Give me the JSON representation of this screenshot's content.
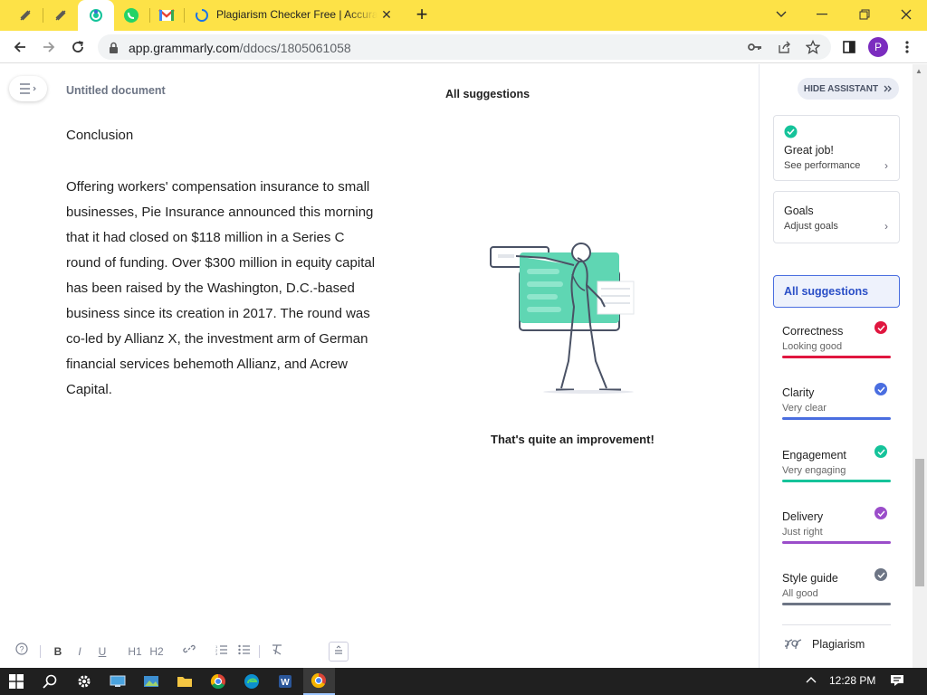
{
  "browser": {
    "tab": {
      "title": "Plagiarism Checker Free | Accurate"
    },
    "url": {
      "host": "app.grammarly.com",
      "path": "/ddocs/1805061058"
    },
    "profile_initial": "P"
  },
  "editor": {
    "doc_title": "Untitled document",
    "heading": "Conclusion",
    "body": "Offering workers' compensation insurance to small businesses, Pie Insurance announced this morning that it had closed on $118 million in a Series C round of funding. Over $300 million in equity capital has been raised by the Washington, D.C.-based business since its creation in 2017. The round was co-led by Allianz X, the investment arm of German financial services behemoth Allianz, and Acrew Capital.",
    "panel_title": "All suggestions",
    "improvement": "That's quite an improvement!",
    "format_bar": {
      "bold": "B",
      "italic": "I",
      "underline": "U",
      "h1": "H1",
      "h2": "H2"
    }
  },
  "assistant": {
    "hide_label": "HIDE ASSISTANT",
    "great_job": {
      "title": "Great job!",
      "subtitle": "See performance"
    },
    "goals": {
      "title": "Goals",
      "subtitle": "Adjust goals"
    },
    "all_suggestions": "All suggestions",
    "categories": [
      {
        "name": "Correctness",
        "status": "Looking good",
        "color": "#e0163f"
      },
      {
        "name": "Clarity",
        "status": "Very clear",
        "color": "#4a6ee0"
      },
      {
        "name": "Engagement",
        "status": "Very engaging",
        "color": "#15c39a"
      },
      {
        "name": "Delivery",
        "status": "Just right",
        "color": "#9b4dca"
      },
      {
        "name": "Style guide",
        "status": "All good",
        "color": "#6d7585"
      }
    ],
    "plagiarism": "Plagiarism"
  },
  "taskbar": {
    "clock": "12:28 PM"
  },
  "colors": {
    "tabbar": "#fde247",
    "accent": "#15c39a",
    "taskbar": "#202020"
  }
}
